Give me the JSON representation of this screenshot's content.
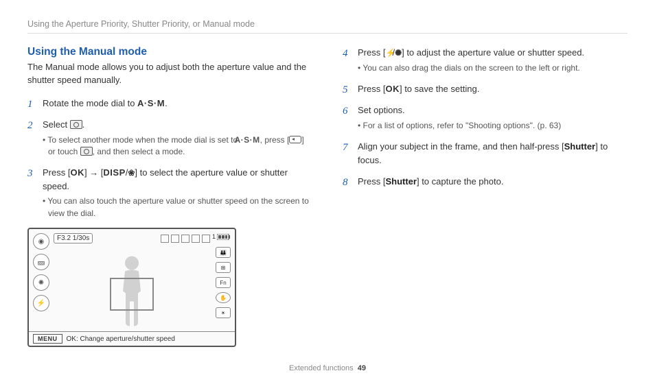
{
  "breadcrumb": "Using the Aperture Priority, Shutter Priority, or Manual mode",
  "section_title": "Using the Manual mode",
  "intro": "The Manual mode allows you to adjust both the aperture value and the shutter speed manually.",
  "glyphs": {
    "asm": "A·S·M",
    "ok": "OK",
    "disp": "DISP"
  },
  "left_steps": {
    "s1_a": "Rotate the mode dial to ",
    "s1_b": ".",
    "s2_a": "Select ",
    "s2_b": ".",
    "s2_sub_a": "To select another mode when the mode dial is set to ",
    "s2_sub_b": ", press [",
    "s2_sub_c": "] or touch ",
    "s2_sub_d": ", and then select a mode.",
    "s3_a": "Press [",
    "s3_b": "] → [",
    "s3_c": "/",
    "s3_d": "] to select the aperture value or shutter speed.",
    "s3_sub": "You can also touch the aperture value or shutter speed on the screen to view the dial."
  },
  "right_steps": {
    "s4_a": "Press [",
    "s4_b": "/",
    "s4_c": "] to adjust the aperture value or shutter speed.",
    "s4_sub": "You can also drag the dials on the screen to the left or right.",
    "s5_a": "Press [",
    "s5_b": "] to save the setting.",
    "s6": "Set options.",
    "s6_sub": "For a list of options, refer to \"Shooting options\". (p. 63)",
    "s7_a": "Align your subject in the frame, and then half-press [",
    "s7_b": "Shutter",
    "s7_c": "] to focus.",
    "s8_a": "Press [",
    "s8_b": "Shutter",
    "s8_c": "] to capture the photo."
  },
  "camera_screen": {
    "exposure_badge": "F3.2 1/30s",
    "bottom_hint": "OK: Change aperture/shutter speed",
    "menu_label": "MENU",
    "counter": "1"
  },
  "footer": {
    "section": "Extended functions",
    "page": "49"
  }
}
